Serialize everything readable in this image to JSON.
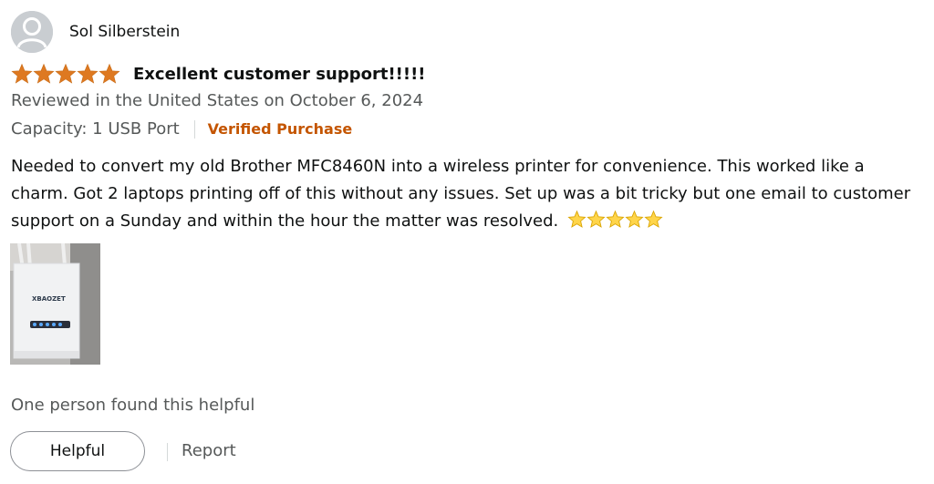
{
  "reviewer": {
    "name": "Sol Silberstein",
    "avatar_icon": "default-user-avatar-icon"
  },
  "rating": {
    "stars": 5,
    "max": 5,
    "star_color": "#de7921"
  },
  "review": {
    "title": "Excellent customer support!!!!!",
    "date_line": "Reviewed in the United States on October 6, 2024",
    "variant": "Capacity: 1 USB Port",
    "verified_label": "Verified Purchase",
    "body": "Needed to convert my old Brother MFC8460N into a wireless printer for convenience. This worked like a charm. Got 2 laptops printing off of this without any issues. Set up was a bit tricky but one email to customer support on a Sunday and within the hour the matter was resolved.",
    "body_emoji": "star-emoji x5"
  },
  "image": {
    "brand_text": "XBAOZET"
  },
  "footer": {
    "helpful_count_text": "One person found this helpful",
    "helpful_button": "Helpful",
    "report_link": "Report"
  },
  "colors": {
    "verified": "#c45500",
    "secondary_text": "#565959",
    "primary_text": "#0f1111"
  }
}
